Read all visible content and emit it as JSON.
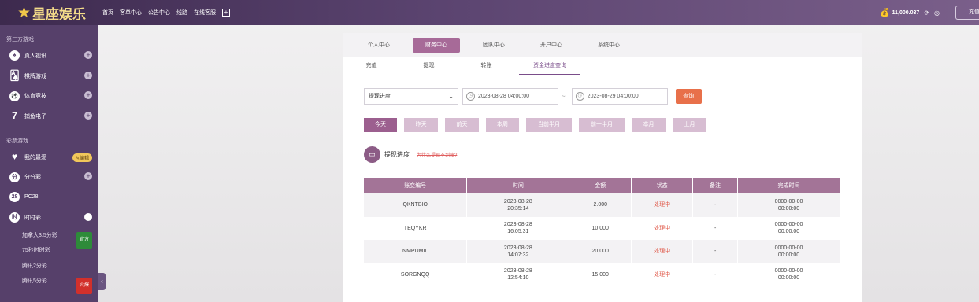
{
  "brand": {
    "name": "星座娱乐"
  },
  "topnav": {
    "items": [
      "首页",
      "客单中心",
      "公告中心",
      "线路",
      "在线客服"
    ]
  },
  "account": {
    "balance": "11,000.037",
    "recharge_label": "充值"
  },
  "sidebar": {
    "section1": "第三方游戏",
    "items1": [
      {
        "icon": "casino-icon",
        "label": "真人视讯"
      },
      {
        "icon": "cards-icon",
        "label": "棋牌游戏"
      },
      {
        "icon": "soccer-icon",
        "label": "体育竞技"
      },
      {
        "icon": "seven-icon",
        "label": "捕鱼电子"
      }
    ],
    "section2": "彩票游戏",
    "items2": [
      {
        "icon": "heart-icon",
        "label": "我的最爱",
        "badge": "✎编辑"
      },
      {
        "icon": "fen-icon",
        "label": "分分彩"
      },
      {
        "icon": "pc28-icon",
        "label": "PC28"
      },
      {
        "icon": "shi-icon",
        "label": "时时彩"
      }
    ],
    "sub_items": [
      {
        "label": "加拿大3.5分彩",
        "badge": "官方"
      },
      {
        "label": "75秒时时彩",
        "badge": ""
      },
      {
        "label": "腾讯2分彩",
        "badge": ""
      },
      {
        "label": "腾讯5分彩",
        "badge": "火爆"
      }
    ]
  },
  "tabs_primary": [
    "个人中心",
    "财务中心",
    "团队中心",
    "开户中心",
    "系统中心"
  ],
  "tabs_primary_active": 1,
  "tabs_secondary": [
    "充值",
    "提现",
    "转账",
    "资金进度查询"
  ],
  "tabs_secondary_active": 3,
  "filters": {
    "type_value": "提现进度",
    "date_start": "2023-08-28 04:00:00",
    "date_end": "2023-08-29 04:00:00",
    "separator": "~",
    "query_label": "查询"
  },
  "quick_ranges": [
    "今天",
    "昨天",
    "前天",
    "本周",
    "当前半月",
    "前一半月",
    "本月",
    "上月"
  ],
  "quick_active": 0,
  "section": {
    "title": "提现进度",
    "help_link": "为什么提现不到账?"
  },
  "table": {
    "columns": [
      "账变编号",
      "时间",
      "金额",
      "状态",
      "备注",
      "完成时间"
    ],
    "rows": [
      {
        "id": "QKNTBIO",
        "time_date": "2023-08-28",
        "time_clock": "20:35:14",
        "amount": "2.000",
        "status": "处理中",
        "note": "-",
        "done_date": "0000-00-00",
        "done_clock": "00:00:00"
      },
      {
        "id": "TEQYKR",
        "time_date": "2023-08-28",
        "time_clock": "16:05:31",
        "amount": "10.000",
        "status": "处理中",
        "note": "-",
        "done_date": "0000-00-00",
        "done_clock": "00:00:00"
      },
      {
        "id": "NMPUMIL",
        "time_date": "2023-08-28",
        "time_clock": "14:07:32",
        "amount": "20.000",
        "status": "处理中",
        "note": "-",
        "done_date": "0000-00-00",
        "done_clock": "00:00:00"
      },
      {
        "id": "SORGNQQ",
        "time_date": "2023-08-28",
        "time_clock": "12:54:10",
        "amount": "15.000",
        "status": "处理中",
        "note": "-",
        "done_date": "0000-00-00",
        "done_clock": "00:00:00"
      }
    ]
  },
  "colors": {
    "header": "#5b4470",
    "accent": "#a76a98",
    "sidebar": "#56406a",
    "status": "#e05a4a",
    "query": "#e8704a"
  }
}
